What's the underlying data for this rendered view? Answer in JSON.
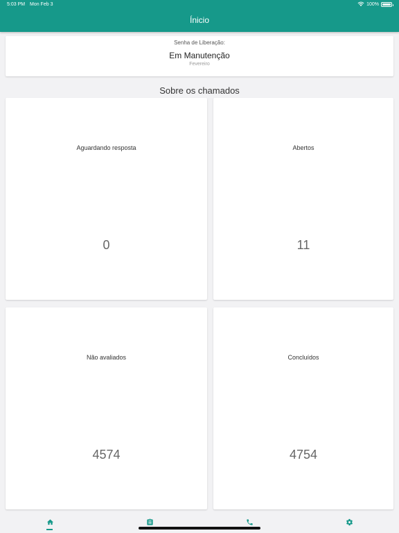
{
  "status_bar": {
    "time": "5:03 PM",
    "date": "Mon Feb 3",
    "battery": "100%"
  },
  "header": {
    "title": "Ínicio"
  },
  "release": {
    "label": "Senha de Liberação:",
    "value": "Em Manutenção",
    "month": "Fevereiro"
  },
  "section": {
    "title": "Sobre os chamados"
  },
  "stats": [
    {
      "label": "Aguardando resposta",
      "value": "0"
    },
    {
      "label": "Abertos",
      "value": "11"
    },
    {
      "label": "Não avaliados",
      "value": "4574"
    },
    {
      "label": "Concluídos",
      "value": "4754"
    }
  ],
  "tabs": [
    {
      "icon": "home-icon",
      "active": true
    },
    {
      "icon": "clipboard-icon",
      "active": false
    },
    {
      "icon": "phone-icon",
      "active": false
    },
    {
      "icon": "gear-icon",
      "active": false
    }
  ],
  "colors": {
    "accent": "#16998a",
    "background": "#f2f2f4"
  }
}
